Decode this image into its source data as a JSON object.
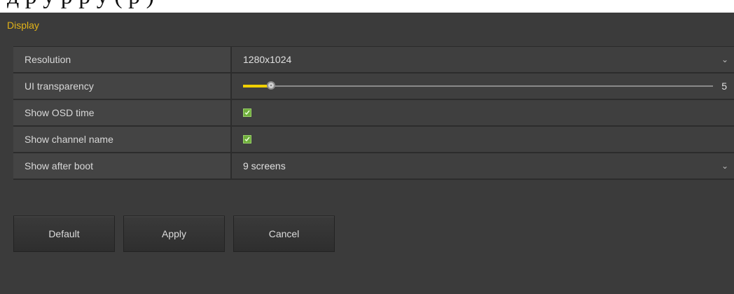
{
  "document_caption": {
    "text": "д      р      у      р      р  у (  р      )"
  },
  "section": {
    "title": "Display"
  },
  "settings": {
    "resolution": {
      "label": "Resolution",
      "value": "1280x1024",
      "control": "dropdown",
      "icon": "chevron-down-icon"
    },
    "ui_transparency": {
      "label": "UI transparency",
      "value": "5",
      "control": "slider",
      "level_fraction": 0.06,
      "accent_color": "#f0d000"
    },
    "show_osd_time": {
      "label": "Show OSD time",
      "checked": true,
      "control": "checkbox",
      "check_color": "#6fae3c"
    },
    "show_channel_name": {
      "label": "Show channel name",
      "checked": true,
      "control": "checkbox",
      "check_color": "#6fae3c"
    },
    "show_after_boot": {
      "label": "Show after boot",
      "value": "9 screens",
      "control": "dropdown",
      "icon": "chevron-down-icon"
    }
  },
  "buttons": {
    "default_label": "Default",
    "apply_label": "Apply",
    "cancel_label": "Cancel"
  },
  "colors": {
    "title_accent": "#e2b318",
    "panel_background": "#3b3b3b"
  }
}
